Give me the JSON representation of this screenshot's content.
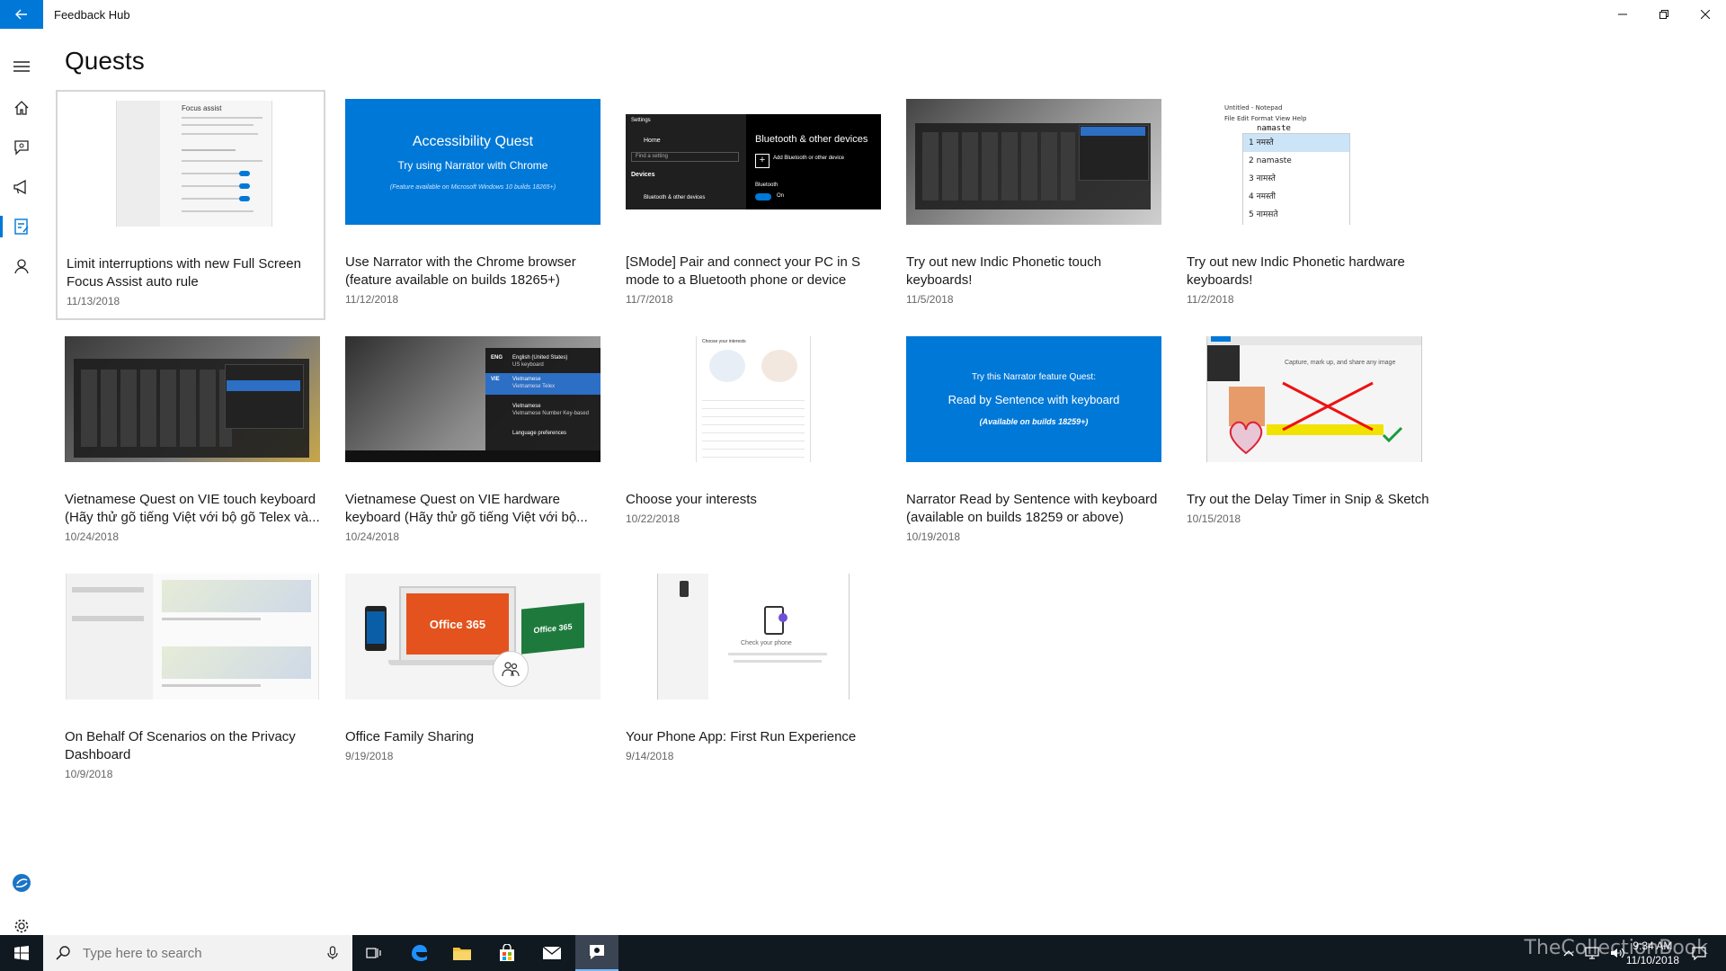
{
  "app": {
    "title": "Feedback Hub"
  },
  "page": {
    "title": "Quests"
  },
  "nav": {
    "items": [
      {
        "name": "menu-icon"
      },
      {
        "name": "home-icon"
      },
      {
        "name": "feedback-icon"
      },
      {
        "name": "announcements-icon"
      },
      {
        "name": "quests-icon",
        "active": true
      },
      {
        "name": "profile-icon"
      }
    ],
    "bottom": [
      {
        "name": "insider-icon"
      },
      {
        "name": "settings-icon"
      }
    ]
  },
  "thumb_text": {
    "accessibility_title": "Accessibility Quest",
    "accessibility_sub": "Try using Narrator with Chrome",
    "accessibility_note": "(Feature available on Microsoft Windows 10 builds 18265+)",
    "settings_label": "Settings",
    "settings_home": "Home",
    "settings_find": "Find a setting",
    "settings_devices": "Devices",
    "settings_bt_nav": "Bluetooth & other devices",
    "bt_heading": "Bluetooth & other devices",
    "bt_add": "Add Bluetooth or other device",
    "bt_label": "Bluetooth",
    "bt_on": "On",
    "notepad_title": "Untitled - Notepad",
    "notepad_menu": "File  Edit  Format  View  Help",
    "notepad_typed": "namaste",
    "notepad_options": [
      "1  नमस्ते",
      "2  namaste",
      "3  नामस्ते",
      "4  नमस्ती",
      "5  नामसते"
    ],
    "narrator_small": "Try this Narrator feature Quest:",
    "narrator_big": "Read by Sentence with keyboard",
    "narrator_note": "(Available on builds 18259+)",
    "office365": "Office 365",
    "office365_small": "Office 365",
    "snip_text": "Capture, mark up, and share any image",
    "phone_text": "Check your phone",
    "interests_text": "Choose your interests"
  },
  "quests": [
    {
      "title": "Limit interruptions with new Full Screen Focus Assist auto rule",
      "date": "11/13/2018",
      "thumb": "focus"
    },
    {
      "title": "Use Narrator with the Chrome browser (feature available on builds 18265+)",
      "date": "11/12/2018",
      "thumb": "accessibility"
    },
    {
      "title": "[SMode] Pair and connect your PC in S mode to a Bluetooth phone or device",
      "date": "11/7/2018",
      "thumb": "bluetooth"
    },
    {
      "title": "Try out new Indic Phonetic touch keyboards!",
      "date": "11/5/2018",
      "thumb": "keyboard"
    },
    {
      "title": "Try out new Indic Phonetic hardware keyboards!",
      "date": "11/2/2018",
      "thumb": "notepad"
    },
    {
      "title": "Vietnamese Quest on VIE touch keyboard (Hãy thử gõ tiếng Việt với bộ gõ Telex và...",
      "date": "10/24/2018",
      "thumb": "keyboard2"
    },
    {
      "title": "Vietnamese Quest on VIE hardware keyboard (Hãy thử gõ tiếng Việt với bộ...",
      "date": "10/24/2018",
      "thumb": "lang"
    },
    {
      "title": "Choose your interests",
      "date": "10/22/2018",
      "thumb": "interests"
    },
    {
      "title": "Narrator Read by Sentence with keyboard (available on builds 18259 or above)",
      "date": "10/19/2018",
      "thumb": "narrator"
    },
    {
      "title": "Try out the Delay Timer in Snip & Sketch",
      "date": "10/15/2018",
      "thumb": "snip"
    },
    {
      "title": "On Behalf Of Scenarios on the Privacy Dashboard",
      "date": "10/9/2018",
      "thumb": "privacy"
    },
    {
      "title": "Office Family Sharing",
      "date": "9/19/2018",
      "thumb": "office"
    },
    {
      "title": "Your Phone App: First Run Experience",
      "date": "9/14/2018",
      "thumb": "phone"
    }
  ],
  "lang_popup": {
    "eng_code": "ENG",
    "eng_name": "English (United States)",
    "eng_kb": "US keyboard",
    "vie_code": "VIE",
    "vie_name": "Vietnamese",
    "vie_kb": "Vietnamese Telex",
    "vie2_name": "Vietnamese",
    "vie2_kb": "Vietnamese Number Key-based",
    "prefs": "Language preferences"
  },
  "taskbar": {
    "search_placeholder": "Type here to search",
    "time": "9:34 AM",
    "date": "11/10/2018",
    "watermark": "TheCollectionBook"
  }
}
